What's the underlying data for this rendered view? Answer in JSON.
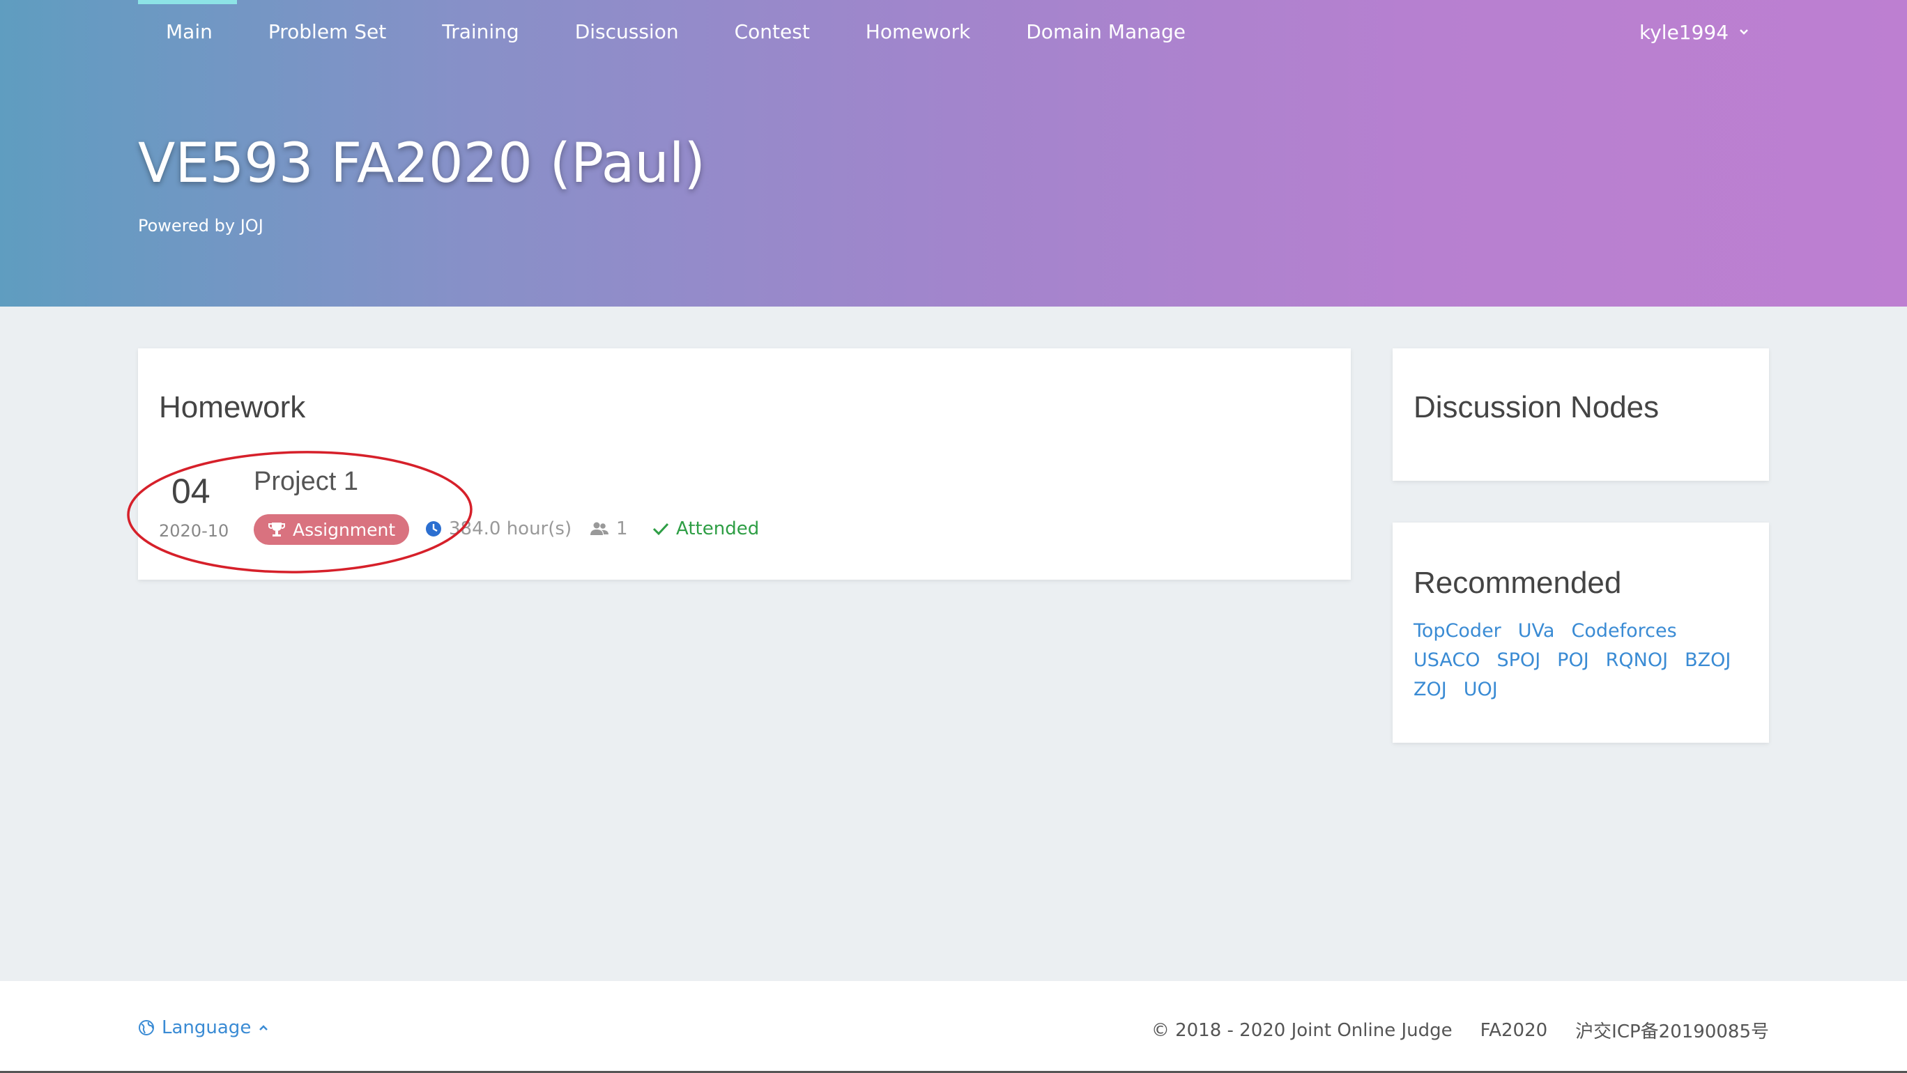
{
  "nav": {
    "items": [
      "Main",
      "Problem Set",
      "Training",
      "Discussion",
      "Contest",
      "Homework",
      "Domain Manage"
    ],
    "user": "kyle1994",
    "active_index": 0
  },
  "hero": {
    "title": "VE593 FA2020 (Paul)",
    "subtitle": "Powered by JOJ"
  },
  "homework": {
    "title": "Homework",
    "items": [
      {
        "day": "04",
        "month": "2020-10",
        "name": "Project 1",
        "badge": "Assignment",
        "duration": "384.0 hour(s)",
        "participants": "1",
        "status": "Attended"
      }
    ]
  },
  "discussion_nodes": {
    "title": "Discussion Nodes"
  },
  "recommended": {
    "title": "Recommended",
    "links": [
      "TopCoder",
      "UVa",
      "Codeforces",
      "USACO",
      "SPOJ",
      "POJ",
      "RQNOJ",
      "BZOJ",
      "ZOJ",
      "UOJ"
    ]
  },
  "footer": {
    "language": "Language",
    "copyright": "© 2018 - 2020 Joint Online Judge",
    "version": "FA2020",
    "icp": "沪交ICP备20190085号"
  },
  "colors": {
    "badge": "#d9727f",
    "link": "#3a8bd4",
    "attended": "#2e9e45",
    "nav_active": "#8de3e6",
    "annotation": "#d6202a"
  },
  "icons": {
    "badge": "trophy-icon",
    "duration": "clock-icon",
    "participants": "people-icon",
    "status": "check-icon",
    "language": "globe-icon",
    "user_menu": "chevron-down-icon",
    "language_menu": "chevron-up-icon"
  }
}
